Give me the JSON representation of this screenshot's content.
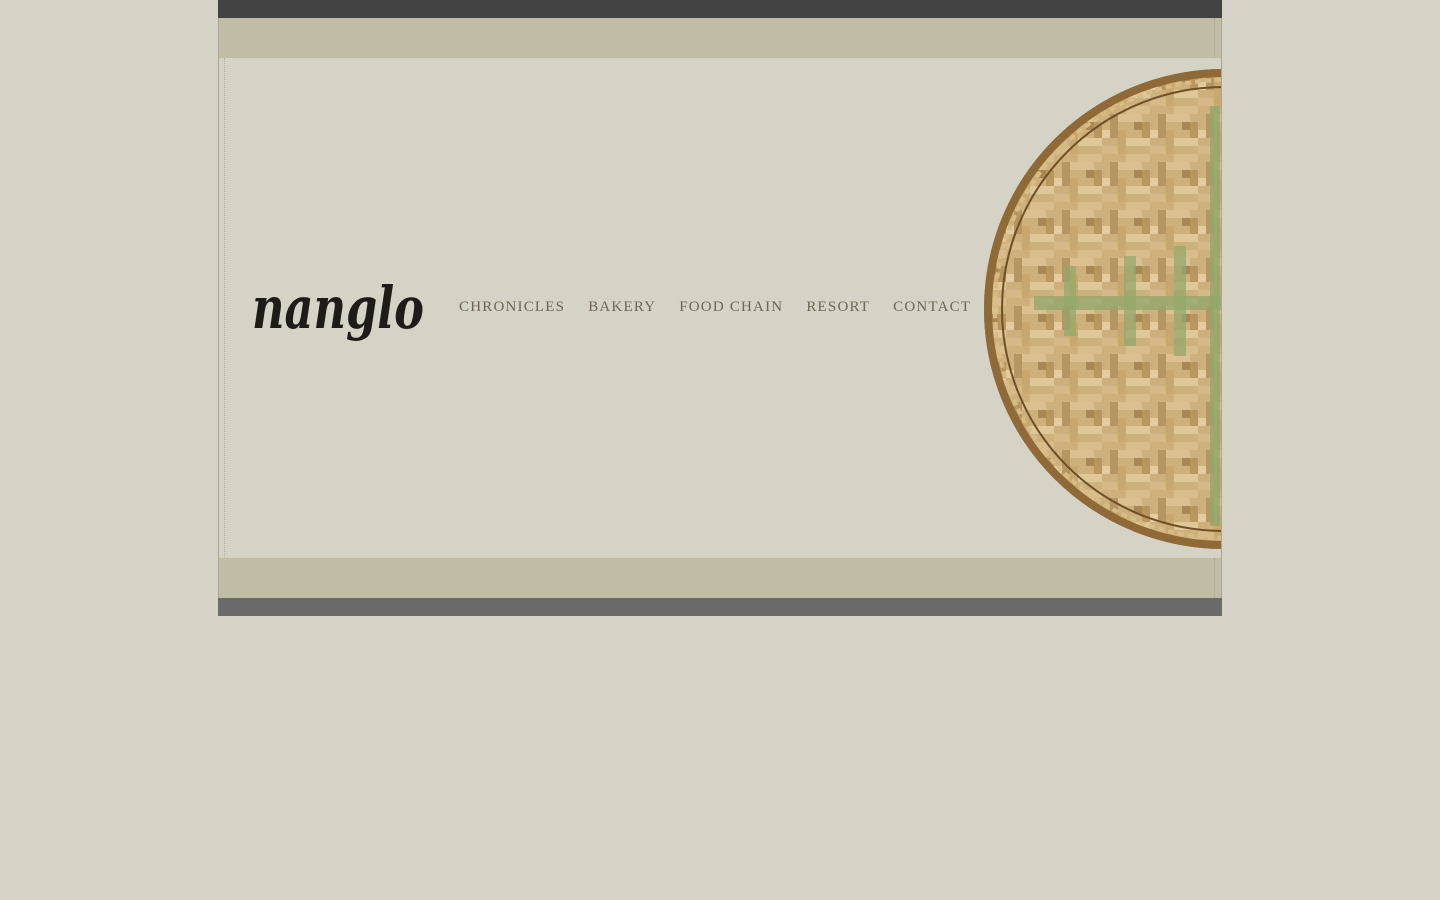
{
  "site": {
    "logo_text": "nanglo"
  },
  "nav": {
    "items": [
      {
        "label": "CHRONICLES"
      },
      {
        "label": "BAKERY"
      },
      {
        "label": "FOOD CHAIN"
      },
      {
        "label": "RESORT"
      },
      {
        "label": "CONTACT"
      }
    ]
  },
  "colors": {
    "page_background": "#d4d3c6",
    "band": "#c1bda5",
    "top_bar": "#434343",
    "bottom_bar": "#6a6a6a",
    "nav_text": "#6e6652",
    "logo": "#1e1c18"
  },
  "images": {
    "hero": "woven-bamboo-tray"
  }
}
